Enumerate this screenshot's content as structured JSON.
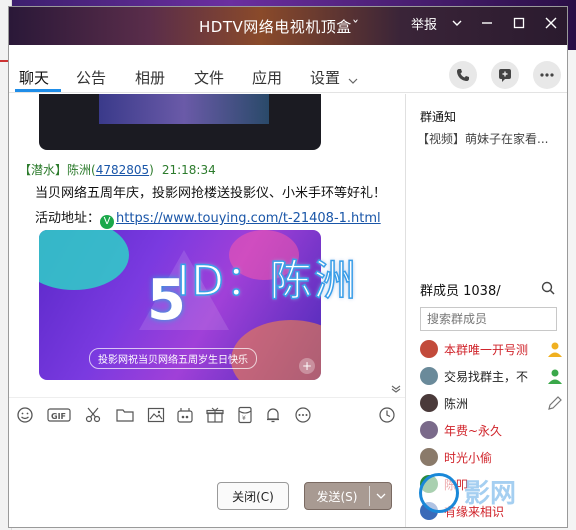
{
  "window": {
    "title": "HDTV网络电视机顶盒ˇ",
    "report_label": "举报"
  },
  "tabs": [
    {
      "label": "聊天"
    },
    {
      "label": "公告"
    },
    {
      "label": "相册"
    },
    {
      "label": "文件"
    },
    {
      "label": "应用"
    },
    {
      "label": "设置"
    }
  ],
  "chat": {
    "message": {
      "header_prefix": "【潜水】陈洲(",
      "user_id": "4782805",
      "header_suffix": ")",
      "time": "21:18:34",
      "line1": "当贝网络五周年庆，投影网抢楼送投影仪、小米手环等好礼！",
      "line2_prefix": "活动地址：",
      "link_badge": "V",
      "link": "https://www.touying.com/t-21408-1.html"
    },
    "banner": {
      "big_text": "5",
      "caption": "投影网祝当贝网络五周岁生日快乐"
    }
  },
  "buttons": {
    "close": "关闭(C)",
    "send": "发送(S)"
  },
  "notice": {
    "title": "群通知",
    "body": "【视频】萌妹子在家看..."
  },
  "members": {
    "title": "群成员 1038/",
    "search_placeholder": "搜索群成员",
    "items": [
      {
        "name": "本群唯一开号测",
        "color": "#d0232a"
      },
      {
        "name": "交易找群主，不",
        "color": "#222222"
      },
      {
        "name": "陈洲",
        "color": "#222222"
      },
      {
        "name": "年费~永久",
        "color": "#d0232a"
      },
      {
        "name": "时光小偷",
        "color": "#d0232a"
      },
      {
        "name": "陈叩",
        "color": "#d0232a"
      },
      {
        "name": "有缘来相识",
        "color": "#d0232a"
      }
    ]
  },
  "watermark": {
    "text": "ID：陈洲",
    "logo_text": "影网"
  },
  "colors": {
    "accent": "#1f8de8",
    "member_red": "#d0232a",
    "link": "#1a56a8"
  }
}
